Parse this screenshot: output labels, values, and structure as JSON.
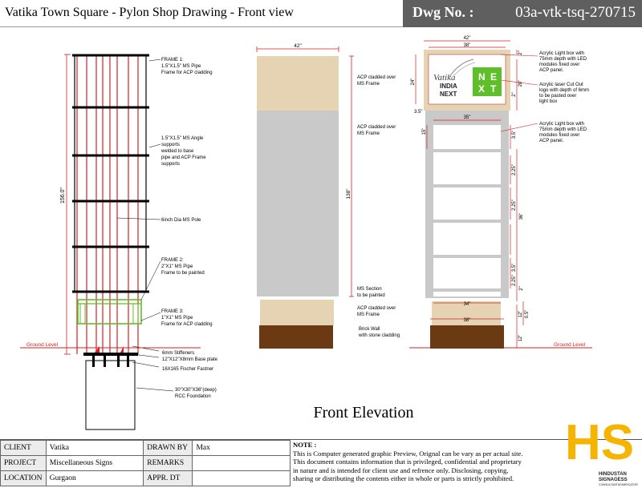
{
  "header": {
    "title": "Vatika Town Square - Pylon Shop Drawing - Front view",
    "dwg_label": "Dwg No. :",
    "dwg_number": "03a-vtk-tsq-270715"
  },
  "drawing": {
    "caption": "Front Elevation",
    "ground_label": "Ground Level",
    "left_frame": {
      "height_dim": "156.0\"",
      "notes": {
        "frame1": [
          "FRAME 1:",
          "1.5\"X1.5\" MS Pipe",
          "Frame for ACP cladding"
        ],
        "angle": [
          "1.5\"X1.5\" MS Angle",
          "supports",
          "welded to base",
          "pipe and ACP Frame",
          "supports"
        ],
        "pole": [
          "6inch Dia MS Pole"
        ],
        "frame2": [
          "FRAME 2:",
          "2\"X1\" MS Pipe",
          "Frame to be painted"
        ],
        "frame3": [
          "FRAME 3:",
          "1\"X1\" MS Pipe",
          "Frame for ACP cladding"
        ],
        "stiffeners": [
          "6mm Stiffeners"
        ],
        "baseplate": [
          "12\"X12\"X8mm Base plate"
        ],
        "fastner": [
          "16X165 Fischer Fastner"
        ],
        "foundation": [
          "30\"X30\"X36\"(deep)",
          "RCC Foundation"
        ]
      }
    },
    "middle": {
      "width_dim": "42\"",
      "height_dim": "138\"",
      "notes": {
        "acp_top": [
          "ACP cladded over",
          "MS Frame"
        ],
        "acp_mid": [
          "ACP cladded over",
          "MS Frame"
        ],
        "ms_section": [
          "MS Section",
          "to be painted"
        ],
        "acp_bottom": [
          "ACP cladded over",
          "MS Frame"
        ],
        "brick": [
          "Brick Wall",
          "with stone cladding"
        ]
      }
    },
    "right": {
      "dims": {
        "w42": "42\"",
        "w38": "38\"",
        "w35": "35\"",
        "w34": "34\"",
        "w38b": "38\"",
        "h24": "24\"",
        "h2a": "2\"",
        "h28": "28\"",
        "h2b": "2\"",
        "h15": "15\"",
        "h35": "3.5\"",
        "h35b": "3.5\"",
        "h225a": "2.25\"",
        "h225b": "2.25\"",
        "h36": "36\"",
        "h35c": "3.5\"",
        "h225c": "2.25\"",
        "h2c": "2\"",
        "h12": "12\"",
        "h05": "0.5\"",
        "h12b": "12\""
      },
      "logo": {
        "vatika": "Vatika",
        "india": "INDIA",
        "next": "NEXT",
        "box_n": "N",
        "box_x": "X",
        "box_e": "E",
        "box_t": "T"
      },
      "notes": {
        "lightbox1": [
          "Acrylic Light box with",
          "75mm depth with LED",
          "modules fixed over",
          "ACP panel."
        ],
        "laser": [
          "Acrylic laser Cut Out",
          "logo with depth of 6mm",
          "to be pasted over",
          "light box"
        ],
        "lightbox2": [
          "Acrylic Light box with",
          "75mm depth with LED",
          "modules fixed over",
          "ACP panel."
        ]
      }
    }
  },
  "footer": {
    "client_label": "CLIENT",
    "client": "Vatika",
    "project_label": "PROJECT",
    "project": "Miscellaneous Signs",
    "location_label": "LOCATION",
    "location": "Gurgaon",
    "drawn_label": "DRAWN BY",
    "drawn": "Max",
    "remarks_label": "REMARKS",
    "remarks": "",
    "appr_label": "APPR. DT",
    "appr": "",
    "note_head": "NOTE :",
    "note_lines": [
      "This is Computer generated graphic Preview, Orignal can be vary as per actual site.",
      "This document contains information that is privileged, confidential and proprietary",
      "in nature and is intended for client use and refrence only. Disclosing, copying,",
      "sharing or distributing the contents either in whole or parts is strictly prohibited."
    ],
    "company_letters": "HS",
    "company_name": "HINDUSTAN",
    "company_sub": "SIGNAGESS",
    "company_tag": "CONSULTANT&FABRICATOR"
  },
  "colors": {
    "red": "#d42020",
    "beige": "#e6d3b3",
    "grey": "#c9c9c9",
    "brown": "#6b3a12",
    "green": "#5fbf2a",
    "logo_yellow": "#f5b400"
  }
}
